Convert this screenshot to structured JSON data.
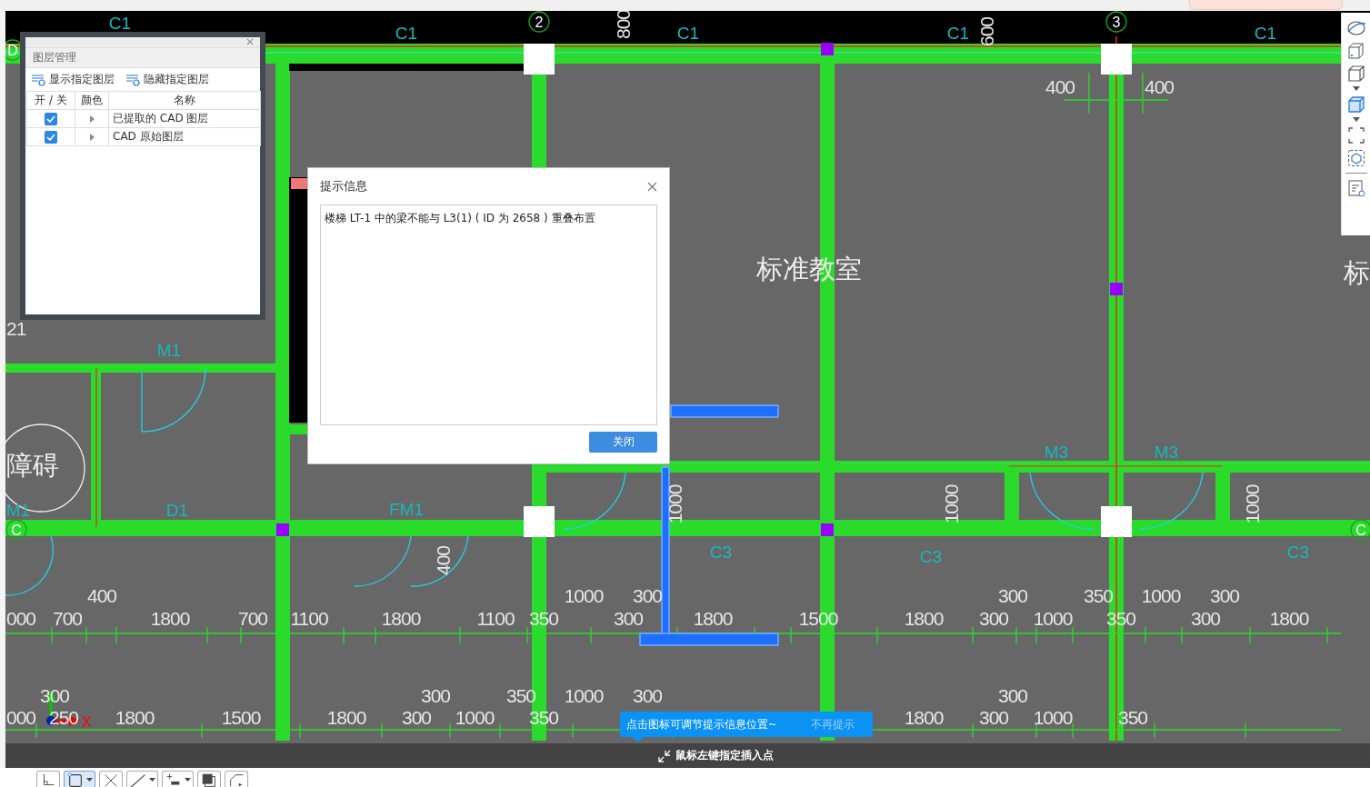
{
  "drawing": {
    "labels": [
      {
        "text": "C1",
        "kind": "tag"
      },
      {
        "text": "C1",
        "kind": "tag"
      },
      {
        "text": "C1",
        "kind": "tag"
      },
      {
        "text": "C1",
        "kind": "tag"
      },
      {
        "text": "C1",
        "kind": "tag"
      },
      {
        "text": "800",
        "kind": "dim"
      },
      {
        "text": "600",
        "kind": "dim"
      },
      {
        "text": "2",
        "kind": "axis"
      },
      {
        "text": "3",
        "kind": "axis"
      },
      {
        "text": "D",
        "kind": "axis"
      },
      {
        "text": "400",
        "kind": "dim"
      },
      {
        "text": "400",
        "kind": "dim"
      },
      {
        "text": "标准教室",
        "kind": "room"
      },
      {
        "text": "标",
        "kind": "room"
      },
      {
        "text": "21",
        "kind": "dim"
      },
      {
        "text": "M1",
        "kind": "tag"
      },
      {
        "text": "障碍",
        "kind": "room"
      },
      {
        "text": "M1",
        "kind": "tag"
      },
      {
        "text": "D1",
        "kind": "tag"
      },
      {
        "text": "FM1",
        "kind": "tag"
      },
      {
        "text": "M3",
        "kind": "tag"
      },
      {
        "text": "M3",
        "kind": "tag"
      },
      {
        "text": "1000",
        "kind": "dim"
      },
      {
        "text": "1000",
        "kind": "dim"
      },
      {
        "text": "1000",
        "kind": "dim"
      },
      {
        "text": "C",
        "kind": "axis"
      },
      {
        "text": "C",
        "kind": "axis"
      },
      {
        "text": "400",
        "kind": "dim"
      },
      {
        "text": "C3",
        "kind": "tag"
      },
      {
        "text": "C3",
        "kind": "tag"
      },
      {
        "text": "C3",
        "kind": "tag"
      },
      {
        "text": "400",
        "kind": "dim"
      },
      {
        "text": "1000",
        "kind": "dim"
      },
      {
        "text": "300",
        "kind": "dim"
      },
      {
        "text": "300",
        "kind": "dim"
      },
      {
        "text": "350",
        "kind": "dim"
      },
      {
        "text": "1000",
        "kind": "dim"
      },
      {
        "text": "300",
        "kind": "dim"
      },
      {
        "text": "000",
        "kind": "dim"
      },
      {
        "text": "700",
        "kind": "dim"
      },
      {
        "text": "1800",
        "kind": "dim"
      },
      {
        "text": "700",
        "kind": "dim"
      },
      {
        "text": "1100",
        "kind": "dim"
      },
      {
        "text": "1800",
        "kind": "dim"
      },
      {
        "text": "1100",
        "kind": "dim"
      },
      {
        "text": "350",
        "kind": "dim"
      },
      {
        "text": "300",
        "kind": "dim"
      },
      {
        "text": "1800",
        "kind": "dim"
      },
      {
        "text": "1500",
        "kind": "dim"
      },
      {
        "text": "1800",
        "kind": "dim"
      },
      {
        "text": "300",
        "kind": "dim"
      },
      {
        "text": "1000",
        "kind": "dim"
      },
      {
        "text": "350",
        "kind": "dim"
      },
      {
        "text": "300",
        "kind": "dim"
      },
      {
        "text": "1800",
        "kind": "dim"
      },
      {
        "text": "300",
        "kind": "dim"
      },
      {
        "text": "300",
        "kind": "dim"
      },
      {
        "text": "350",
        "kind": "dim"
      },
      {
        "text": "1000",
        "kind": "dim"
      },
      {
        "text": "300",
        "kind": "dim"
      },
      {
        "text": "300",
        "kind": "dim"
      },
      {
        "text": "000",
        "kind": "dim"
      },
      {
        "text": "250",
        "kind": "dim"
      },
      {
        "text": "X",
        "kind": "axis-x"
      },
      {
        "text": "1800",
        "kind": "dim"
      },
      {
        "text": "1500",
        "kind": "dim"
      },
      {
        "text": "1800",
        "kind": "dim"
      },
      {
        "text": "300",
        "kind": "dim"
      },
      {
        "text": "1000",
        "kind": "dim"
      },
      {
        "text": "350",
        "kind": "dim"
      },
      {
        "text": "1800",
        "kind": "dim"
      },
      {
        "text": "300",
        "kind": "dim"
      },
      {
        "text": "1000",
        "kind": "dim"
      },
      {
        "text": "350",
        "kind": "dim"
      }
    ]
  },
  "layer_panel": {
    "title": "图层管理",
    "actions": [
      {
        "label": "显示指定图层"
      },
      {
        "label": "隐藏指定图层"
      }
    ],
    "columns": [
      "开 / 关",
      "颜色",
      "名称"
    ],
    "rows": [
      {
        "checked": true,
        "expanded": false,
        "name": "已提取的 CAD 图层"
      },
      {
        "checked": true,
        "expanded": false,
        "name": "CAD 原始图层"
      }
    ]
  },
  "dialog": {
    "title": "提示信息",
    "message": "楼梯 LT-1 中的梁不能与 L3(1) ( ID 为 2658 ) 重叠布置",
    "button": "关闭"
  },
  "hint": {
    "text": "点击图标可调节提示信息位置~",
    "dismiss": "不再提示"
  },
  "status_bar": {
    "prompt": "鼠标左键指定插入点"
  },
  "snap_toolbar": {
    "buttons": [
      {
        "kind": "ortho",
        "selected": false
      },
      {
        "kind": "rect",
        "selected": true
      },
      {
        "kind": "cross",
        "selected": false
      },
      {
        "kind": "angle",
        "selected": false
      },
      {
        "kind": "offset",
        "selected": false
      },
      {
        "kind": "layers",
        "selected": false
      },
      {
        "kind": "polyline",
        "selected": false
      }
    ]
  }
}
